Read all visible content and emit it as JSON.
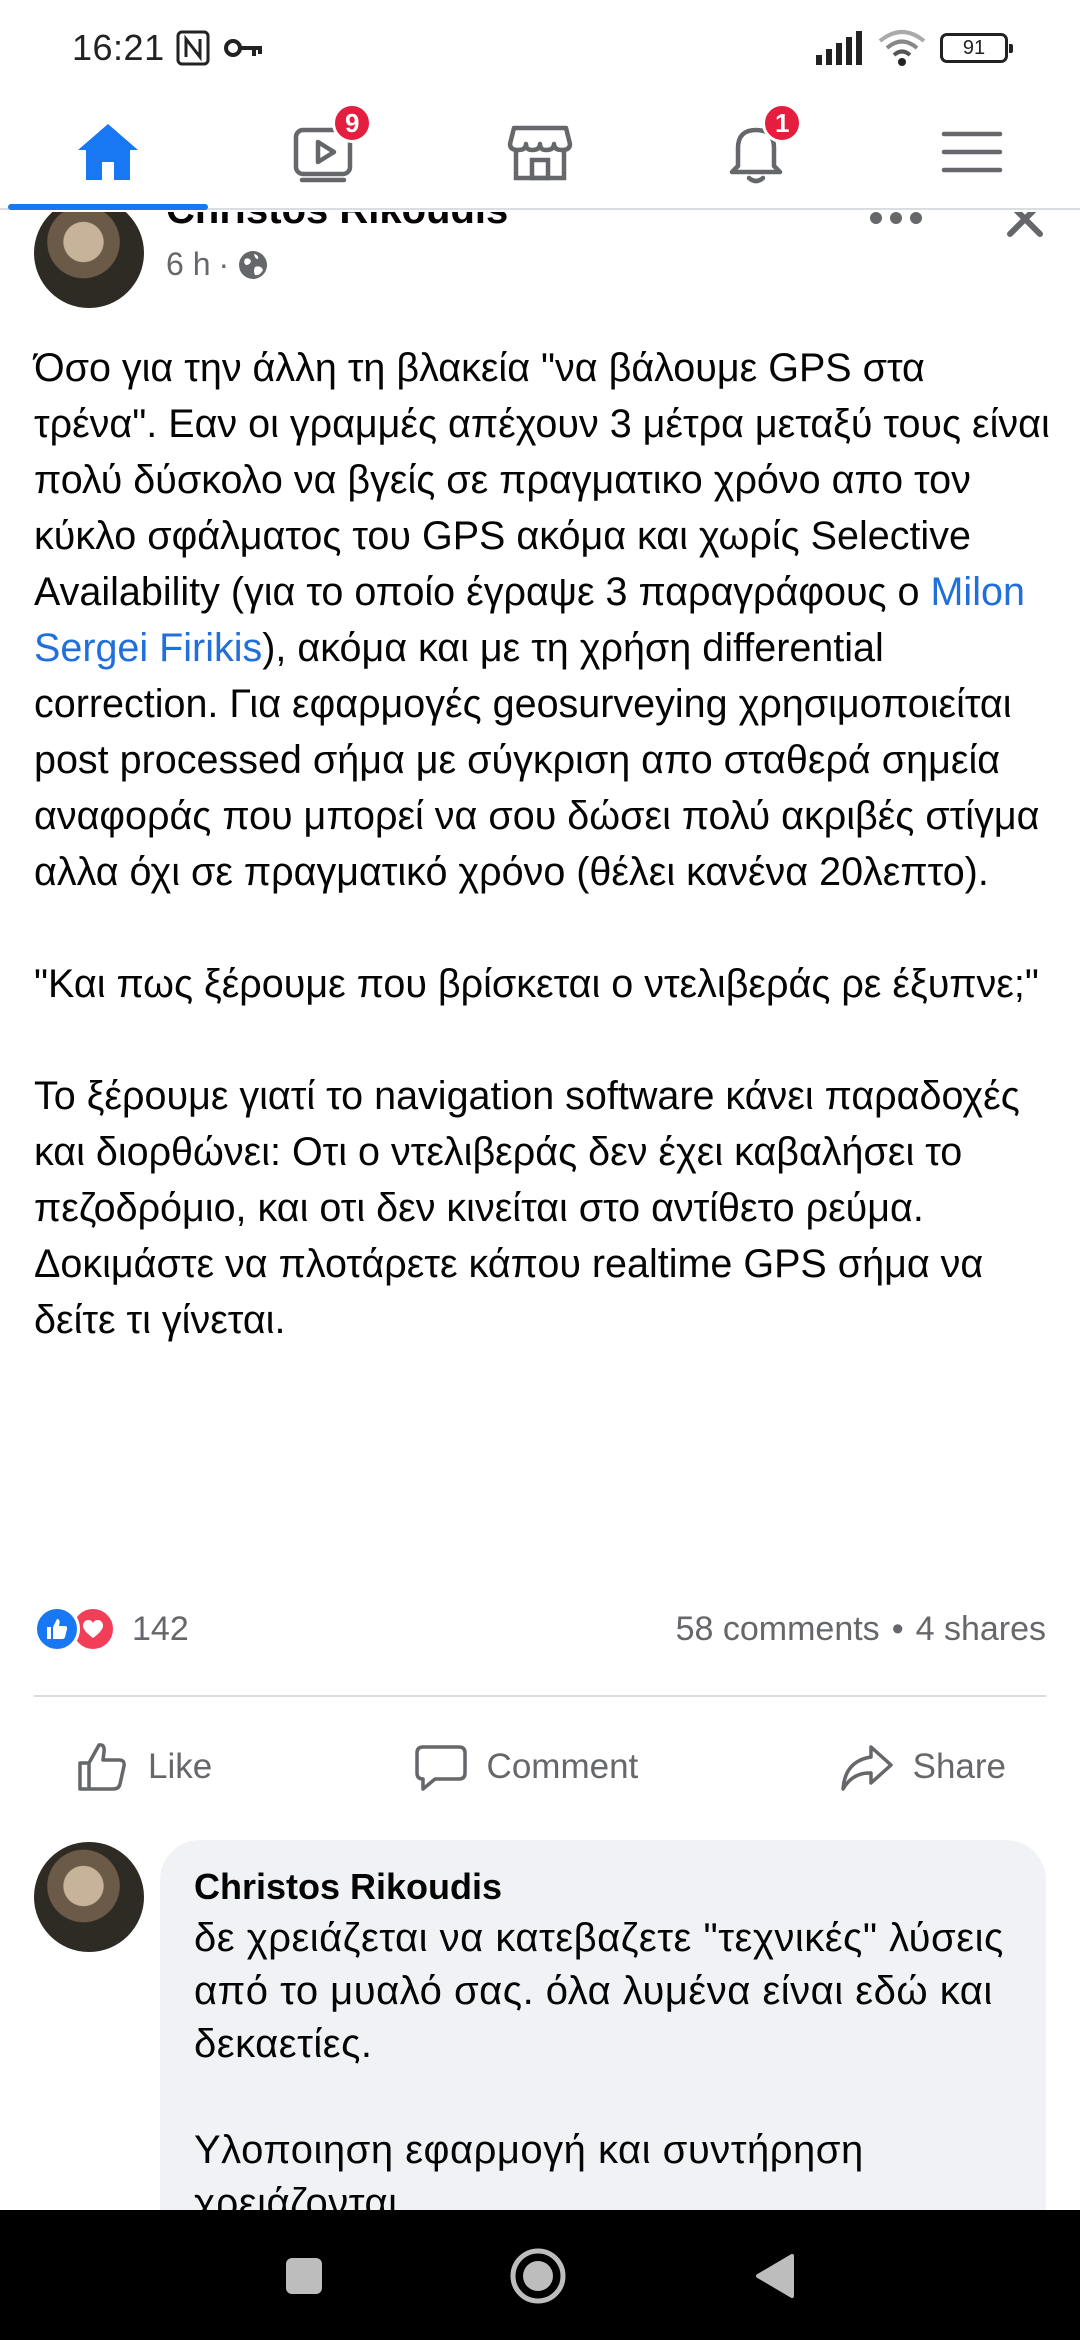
{
  "status_bar": {
    "time": "16:21",
    "battery_level": "91",
    "icons": [
      "nfc-icon",
      "key-icon",
      "signal-icon",
      "wifi-icon",
      "battery-icon"
    ]
  },
  "top_nav": {
    "items": [
      {
        "name": "home",
        "icon": "home-icon",
        "active": true
      },
      {
        "name": "watch",
        "icon": "video-icon",
        "badge": "9"
      },
      {
        "name": "marketplace",
        "icon": "shop-icon"
      },
      {
        "name": "notifications",
        "icon": "bell-icon",
        "badge": "1"
      },
      {
        "name": "menu",
        "icon": "hamburger-menu-icon"
      }
    ],
    "accent_color": "#1877f2",
    "badge_color": "#e41e3f"
  },
  "post": {
    "author": "Christos Rikoudis",
    "time": "6 h",
    "separator": "·",
    "privacy_icon": "globe-icon",
    "body_before_mention": "Όσο για την άλλη τη βλακεία \"να βάλουμε GPS στα τρένα\". Εαν οι γραμμές απέχουν 3 μέτρα μεταξύ τους είναι πολύ δύσκολο να βγείς σε πραγματικο χρόνο απο τον κύκλο σφάλματος του GPS ακόμα και χωρίς Selective Availability (για το οποίο έγραψε 3 παραγράφους ο ",
    "mention": "Milon Sergei Firikis",
    "body_after_mention": "), ακόμα και με τη χρήση differential correction. Για εφαρμογές geosurveying χρησιμοποιείται post processed σήμα με σύγκριση απο σταθερά σημεία αναφοράς που μπορεί να σου δώσει πολύ ακριβές στίγμα αλλα όχι σε πραγματικό χρόνο (θέλει κανένα 20λεπτο).\n\n\"Και πως ξέρουμε που βρίσκεται ο ντελιβεράς ρε έξυπνε;\"\n\nΤο ξέρουμε γιατί το navigation software κάνει παραδοχές και διορθώνει: Οτι ο ντελιβεράς δεν έχει καβαλήσει το πεζοδρόμιο, και οτι δεν κινείται στο αντίθετο ρεύμα. Δοκιμάστε να πλοτάρετε κάπου realtime GPS σήμα να δείτε τι γίνεται.",
    "mention_color": "#216fdb",
    "reaction_count": "142",
    "comments": "58 comments",
    "dot": "•",
    "shares": "4 shares",
    "actions": {
      "like": "Like",
      "comment": "Comment",
      "share": "Share"
    }
  },
  "comment": {
    "author": "Christos Rikoudis",
    "text": "δε χρειάζεται να κατεβαζετε \"τεχνικές\" λύσεις από το μυαλό σας. όλα λυμένα είναι εδώ και δεκαετίες.\n\nΥλοποιηση εφαρμογή και συντήρηση χρειάζονται."
  },
  "android_nav": {
    "buttons": [
      "recents-square-icon",
      "home-circle-icon",
      "back-triangle-icon"
    ]
  }
}
